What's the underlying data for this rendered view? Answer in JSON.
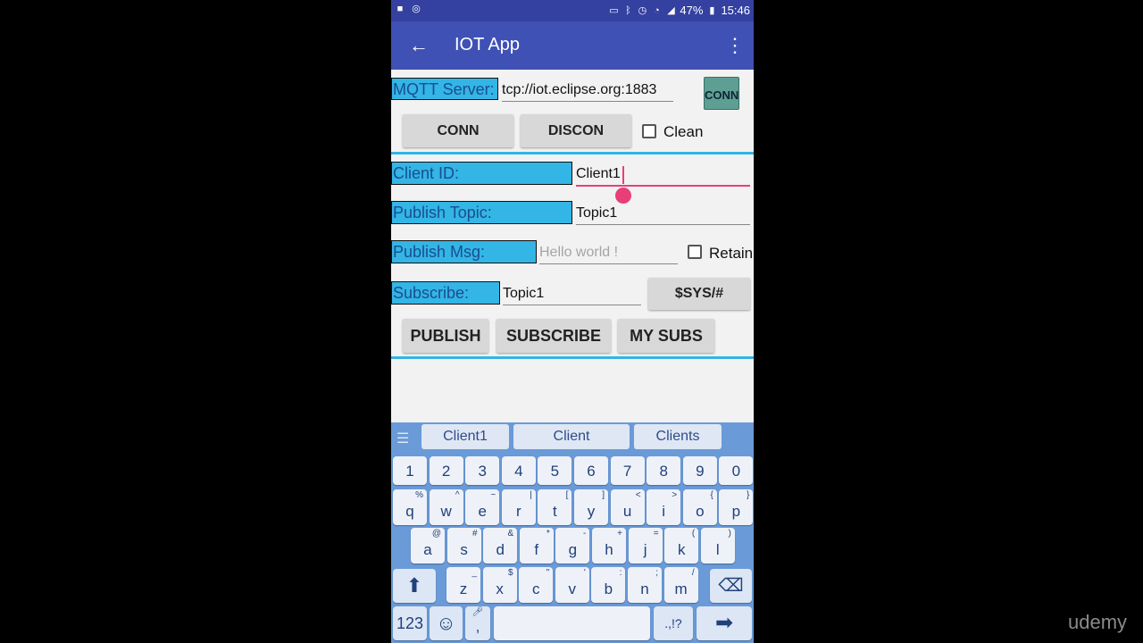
{
  "status_bar": {
    "battery": "47%",
    "time": "15:46"
  },
  "app_bar": {
    "title": "IOT App"
  },
  "mqtt": {
    "server_label": "MQTT Server:",
    "server_value": "tcp://iot.eclipse.org:1883",
    "conn_status": "CONN",
    "conn_button": "CONN",
    "discon_button": "DISCON",
    "clean_label": "Clean"
  },
  "form": {
    "client_id_label": "Client ID:",
    "client_id_value": "Client1",
    "publish_topic_label": "Publish Topic:",
    "publish_topic_value": "Topic1",
    "publish_msg_label": "Publish Msg:",
    "publish_msg_placeholder": "Hello world !",
    "retain_label": "Retain",
    "subscribe_label": "Subscribe:",
    "subscribe_value": "Topic1",
    "sys_button": "$SYS/#"
  },
  "actions": {
    "publish": "PUBLISH",
    "subscribe": "SUBSCRIBE",
    "my_subs": "MY SUBS"
  },
  "keyboard": {
    "suggestions": [
      "Client1",
      "Client",
      "Clients"
    ],
    "numbers": [
      "1",
      "2",
      "3",
      "4",
      "5",
      "6",
      "7",
      "8",
      "9",
      "0"
    ],
    "row1": [
      [
        "q",
        "%"
      ],
      [
        "w",
        "^"
      ],
      [
        "e",
        "~"
      ],
      [
        "r",
        "|"
      ],
      [
        "t",
        "["
      ],
      [
        "y",
        "]"
      ],
      [
        "u",
        "<"
      ],
      [
        "i",
        ">"
      ],
      [
        "o",
        "{"
      ],
      [
        "p",
        "}"
      ]
    ],
    "row2": [
      [
        "a",
        "@"
      ],
      [
        "s",
        "#"
      ],
      [
        "d",
        "&"
      ],
      [
        "f",
        "*"
      ],
      [
        "g",
        "-"
      ],
      [
        "h",
        "+"
      ],
      [
        "j",
        "="
      ],
      [
        "k",
        "("
      ],
      [
        "l",
        ")"
      ]
    ],
    "row3": [
      [
        "z",
        "_"
      ],
      [
        "x",
        "$"
      ],
      [
        "c",
        "\""
      ],
      [
        "v",
        "'"
      ],
      [
        "b",
        ":"
      ],
      [
        "n",
        ";"
      ],
      [
        "m",
        "/"
      ]
    ],
    "sym_key": "123",
    "punct_key": ".,!?",
    "comma_key": ","
  },
  "watermark": "udemy"
}
